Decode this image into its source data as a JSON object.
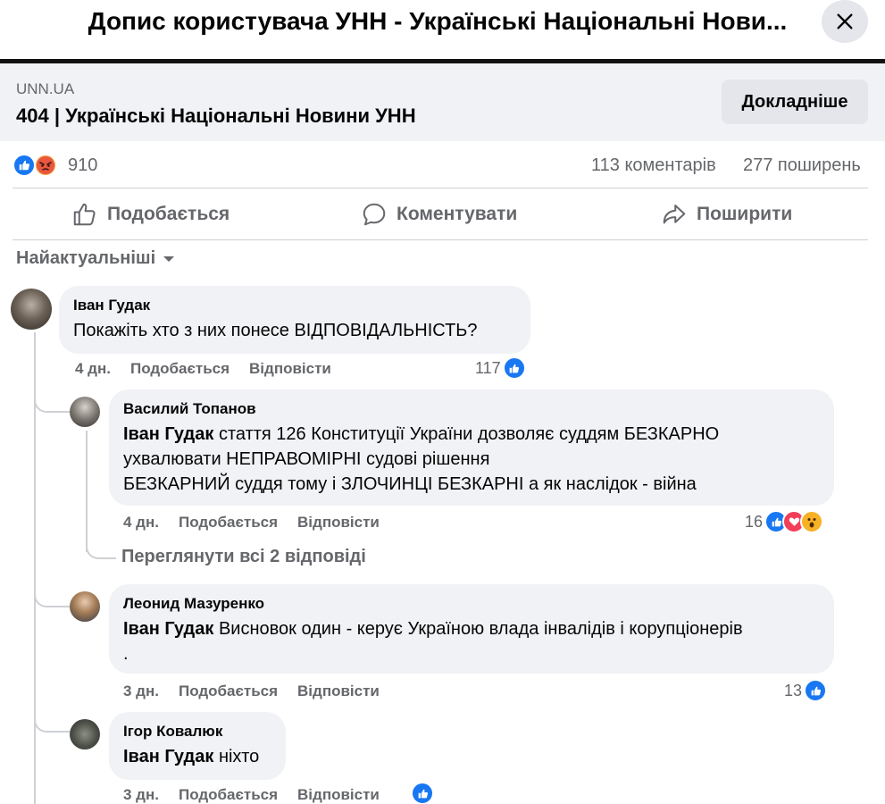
{
  "header": {
    "title": "Допис користувача УНН - Українські Національні Нови..."
  },
  "link_preview": {
    "domain": "UNN.UA",
    "title": "404 | Українські Національні Новини УНН",
    "button_label": "Докладніше"
  },
  "stats": {
    "reactions": "910",
    "comments": "113 коментарів",
    "shares": "277 поширень"
  },
  "actions": {
    "like": "Подобається",
    "comment": "Коментувати",
    "share": "Поширити"
  },
  "sort_label": "Найактуальніші",
  "comments": [
    {
      "author": "Іван Гудак",
      "mention": "",
      "text": "Покажіть хто з них понесе ВІДПОВІДАЛЬНІСТЬ?",
      "time": "4 дн.",
      "like_label": "Подобається",
      "reply_label": "Відповісти",
      "reaction_count": "117"
    },
    {
      "author": "Василий Топанов",
      "mention": "Іван Гудак",
      "text": " стаття 126 Конституції України дозволяє суддям БЕЗКАРНО",
      "text_line2": "ухвалювати НЕПРАВОМІРНІ судові рішення",
      "text_line3": "БЕЗКАРНИЙ суддя тому і ЗЛОЧИНЦІ БЕЗКАРНІ а як наслідок - війна",
      "time": "4 дн.",
      "like_label": "Подобається",
      "reply_label": "Відповісти",
      "reaction_count": "16"
    },
    {
      "author": "Леонид Мазуренко",
      "mention": "Іван Гудак",
      "text": " Висновок один - керує Україною влада інвалідів і корупціонерів",
      "text_line2": ".",
      "time": "3 дн.",
      "like_label": "Подобається",
      "reply_label": "Відповісти",
      "reaction_count": "13"
    },
    {
      "author": "Ігор Ковалюк",
      "mention": "Іван Гудак",
      "text": " ніхто",
      "time": "3 дн.",
      "like_label": "Подобається",
      "reply_label": "Відповісти",
      "reaction_count": ""
    }
  ],
  "view_all_replies": "Переглянути всі 2 відповіді",
  "colors": {
    "accent": "#1877f2",
    "bubble": "#f0f2f5",
    "muted_text": "#65676b"
  }
}
